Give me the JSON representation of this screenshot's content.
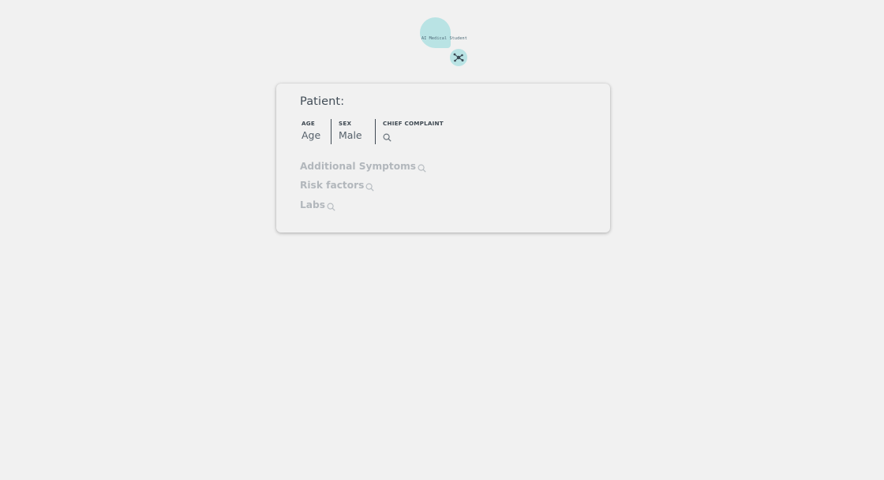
{
  "logo": {
    "text": "AI Medical Student",
    "colors": {
      "bubble": "#b9e3e4",
      "icon": "#3b4a55"
    },
    "icon": "network-nodes-icon"
  },
  "card": {
    "title": "Patient:",
    "fields": {
      "age": {
        "label": "AGE",
        "value": "Age"
      },
      "sex": {
        "label": "SEX",
        "value": "Male"
      },
      "chief_complaint": {
        "label": "CHIEF COMPLAINT",
        "icon": "search-icon"
      }
    },
    "sections": [
      {
        "label": "Additional Symptoms",
        "icon": "search-icon"
      },
      {
        "label": "Risk factors",
        "icon": "search-icon"
      },
      {
        "label": "Labs",
        "icon": "search-icon"
      }
    ]
  }
}
